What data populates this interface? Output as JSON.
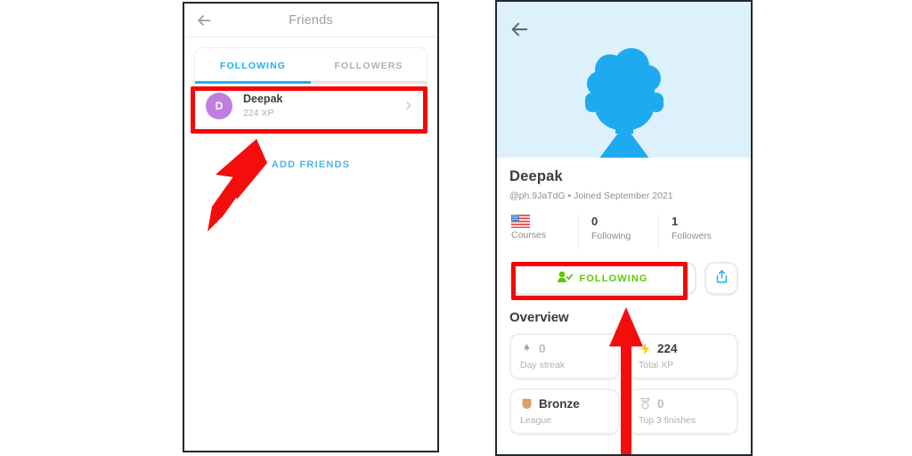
{
  "colors": {
    "accent_blue": "#1cb0f6",
    "hero_bg": "#ddf1fc",
    "silhouette": "#1eaaf1",
    "avatar_purple": "#c07ee0",
    "follow_green": "#58cc02",
    "highlight_red": "#f80505",
    "text_dark": "#3c3c3c",
    "text_muted": "#8e8e8e"
  },
  "left_panel": {
    "name": "friends-screen",
    "header": {
      "back_icon": "back-arrow-icon",
      "title": "Friends"
    },
    "tabs": [
      {
        "label": "FOLLOWING",
        "active": true
      },
      {
        "label": "FOLLOWERS",
        "active": false
      }
    ],
    "friend_row": {
      "avatar_initial": "D",
      "name": "Deepak",
      "xp": "224 XP",
      "chevron_icon": "chevron-right-icon"
    },
    "add_friends_label": "ADD FRIENDS"
  },
  "right_panel": {
    "name": "profile-screen",
    "back_icon": "back-arrow-icon",
    "avatar_icon": "user-silhouette-icon",
    "profile": {
      "name": "Deepak",
      "meta": "@ph.9JaTdG • Joined September 2021"
    },
    "stats": [
      {
        "icon": "us-flag-icon",
        "value": "",
        "label": "Courses"
      },
      {
        "icon": "",
        "value": "0",
        "label": "Following"
      },
      {
        "icon": "",
        "value": "1",
        "label": "Followers"
      }
    ],
    "follow_button": {
      "label": "FOLLOWING",
      "icon": "person-check-icon"
    },
    "share_button": {
      "icon": "share-icon"
    },
    "overview": {
      "title": "Overview",
      "cards": [
        {
          "icon": "flame-icon",
          "value": "0",
          "label": "Day streak",
          "muted": true
        },
        {
          "icon": "bolt-icon",
          "value": "224",
          "label": "Total XP",
          "muted": false
        },
        {
          "icon": "shield-icon",
          "value": "Bronze",
          "label": "League",
          "muted": false
        },
        {
          "icon": "medal-icon",
          "value": "0",
          "label": "Top 3 finishes",
          "muted": true
        }
      ]
    }
  },
  "annotations": [
    {
      "name": "highlight-friend-row",
      "type": "red-rectangle"
    },
    {
      "name": "highlight-following-button",
      "type": "red-rectangle"
    },
    {
      "name": "pointer-arrow-friend-row",
      "type": "red-arrow-diagonal"
    },
    {
      "name": "pointer-arrow-following",
      "type": "red-arrow-vertical"
    }
  ],
  "watermark": {
    "text": ""
  }
}
